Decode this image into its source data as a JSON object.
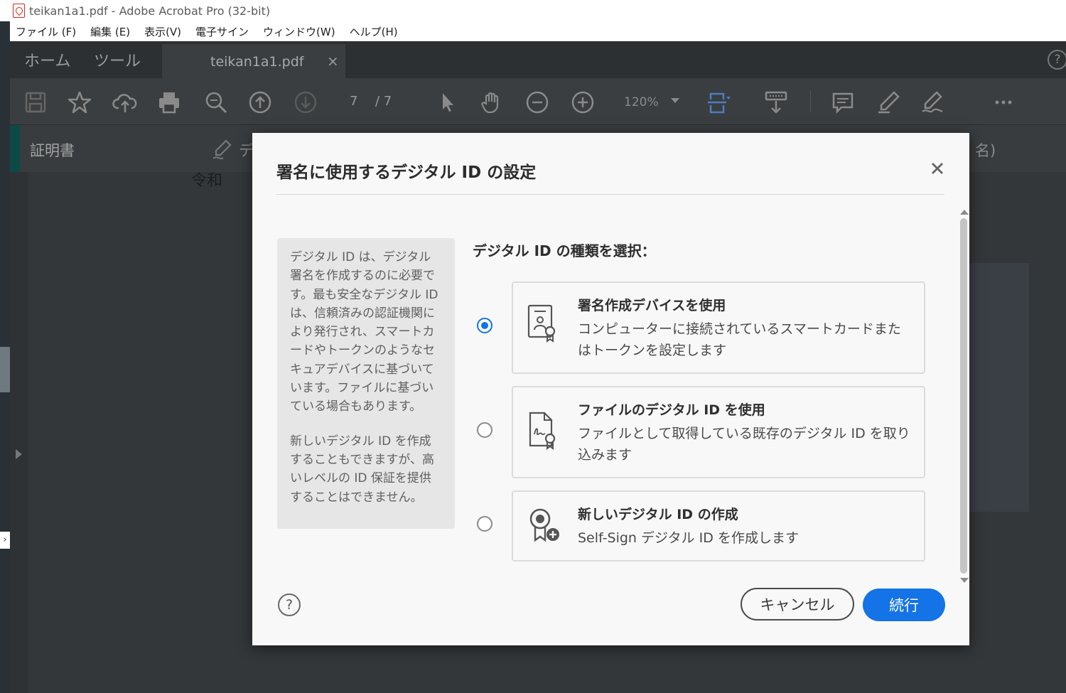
{
  "window": {
    "title": "teikan1a1.pdf - Adobe Acrobat Pro (32-bit)"
  },
  "menubar": {
    "items": [
      "ファイル (F)",
      "編集 (E)",
      "表示(V)",
      "電子サイン",
      "ウィンドウ(W)",
      "ヘルプ(H)"
    ]
  },
  "app": {
    "tabs": {
      "home": "ホーム",
      "tools": "ツール"
    },
    "doc_tab": {
      "name": "teikan1a1.pdf",
      "close": "×"
    },
    "help": "?",
    "toolbar": {
      "page_current": "7",
      "page_total": "/ 7",
      "zoom": "120%"
    },
    "subbar": {
      "label": "証明書",
      "tail_left": "デ",
      "tail_right": "名)"
    },
    "document": {
      "text": "令和"
    }
  },
  "dialog": {
    "title": "署名に使用するデジタル ID の設定",
    "info": {
      "paragraph1": "デジタル ID は、デジタル署名を作成するのに必要です。最も安全なデジタル ID は、信頼済みの認証機関により発行され、スマートカードやトークンのようなセキュアデバイスに基づいています。ファイルに基づいている場合もあります。",
      "paragraph2": "新しいデジタル ID を作成することもできますが、高いレベルの ID 保証を提供することはできません。"
    },
    "choose_label": "デジタル ID の種類を選択：",
    "options": [
      {
        "title": "署名作成デバイスを使用",
        "description": "コンピューターに接続されているスマートカードまたはトークンを設定します",
        "selected": true,
        "icon": "device-certificate-icon"
      },
      {
        "title": "ファイルのデジタル ID を使用",
        "description": "ファイルとして取得している既存のデジタル ID を取り込みます",
        "selected": false,
        "icon": "file-certificate-icon"
      },
      {
        "title": "新しいデジタル ID の作成",
        "description": "Self-Sign デジタル ID を作成します",
        "selected": false,
        "icon": "new-certificate-icon"
      }
    ],
    "help": "?",
    "buttons": {
      "cancel": "キャンセル",
      "continue": "続行"
    },
    "colors": {
      "accent": "#1473e6"
    }
  }
}
